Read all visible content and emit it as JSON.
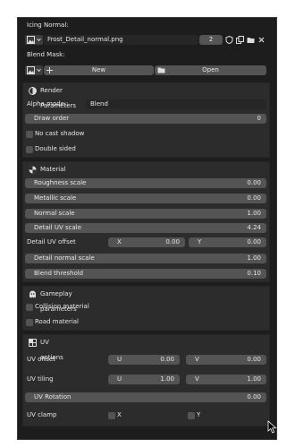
{
  "icing_normal": {
    "label": "Icing Normal:",
    "filename": "Frost_Detail_normal.png",
    "users": "2"
  },
  "blend_mask": {
    "label": "Blend Mask:",
    "new_label": "New",
    "open_label": "Open"
  },
  "render": {
    "title": "Render Parameters",
    "alpha_label": "Alpha mode::",
    "alpha_value": "Blend",
    "draw_order_label": "Draw order",
    "draw_order_value": "0",
    "no_cast_shadow": "No cast shadow",
    "double_sided": "Double sided"
  },
  "material": {
    "title": "Material properties",
    "roughness_label": "Roughness scale",
    "roughness_value": "0.00",
    "metallic_label": "Metallic scale",
    "metallic_value": "0.00",
    "normal_label": "Normal scale",
    "normal_value": "1.00",
    "detail_uv_label": "Detail UV scale",
    "detail_uv_value": "4.24",
    "detail_offset_label": "Detail UV offset",
    "x_label": "X",
    "x_value": "0.00",
    "y_label": "Y",
    "y_value": "0.00",
    "detail_normal_label": "Detail normal scale",
    "detail_normal_value": "1.00",
    "blend_threshold_label": "Blend threshold",
    "blend_threshold_value": "0.10"
  },
  "gameplay": {
    "title": "Gameplay parameters",
    "collision": "Collision material",
    "road": "Road material"
  },
  "uv": {
    "title": "UV options",
    "offset_label": "UV offset",
    "offset_u_label": "U",
    "offset_u_value": "0.00",
    "offset_v_label": "V",
    "offset_v_value": "0.00",
    "tiling_label": "UV tiling",
    "tiling_u_label": "U",
    "tiling_u_value": "1.00",
    "tiling_v_label": "V",
    "tiling_v_value": "1.00",
    "rotation_label": "UV Rotation",
    "rotation_value": "0.00",
    "clamp_label": "UV clamp",
    "clamp_x": "X",
    "clamp_y": "Y"
  },
  "colors": {
    "background": "#1d1d1d",
    "panel": "#2c2c2c",
    "field": "#545454",
    "text": "#e6e6e6"
  }
}
